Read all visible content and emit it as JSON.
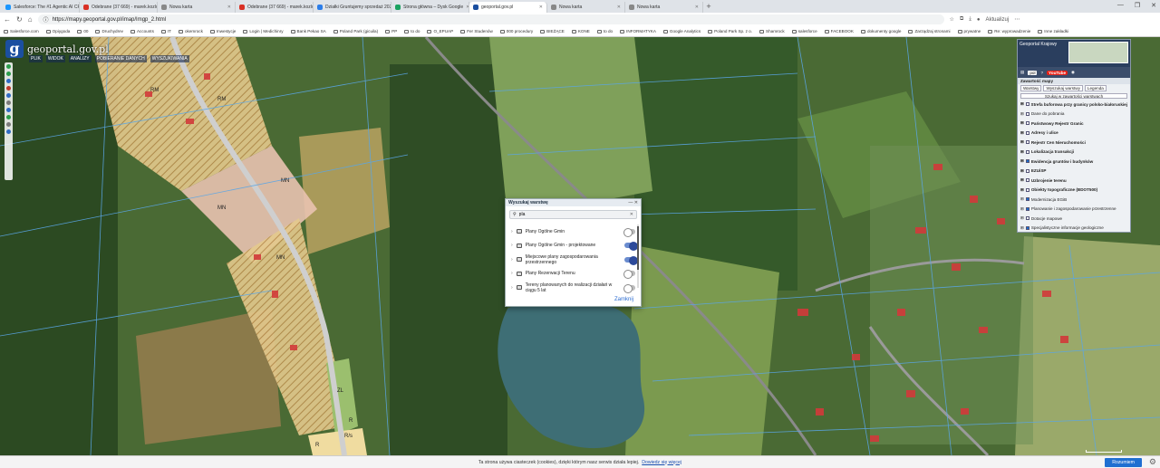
{
  "browser": {
    "tabs": [
      {
        "title": "Salesforce: The #1 Agentic AI CR",
        "color": "#1b96ff"
      },
      {
        "title": "Odebrane (37 669) - marek.kozlo",
        "color": "#d93025"
      },
      {
        "title": "Nowa karta",
        "color": "#888888"
      },
      {
        "title": "Odebrane (37 669) - marek.kozlo",
        "color": "#d93025"
      },
      {
        "title": "Działki Gruntujemy sprzedaż 2021",
        "color": "#2b7de9"
      },
      {
        "title": "Strona główna – Dysk Google",
        "color": "#1aa260"
      },
      {
        "title": "geoportal.gov.pl",
        "color": "#1b4fa0",
        "active": true
      },
      {
        "title": "Nowa karta",
        "color": "#888888"
      },
      {
        "title": "Nowa karta",
        "color": "#888888"
      }
    ],
    "url": "https://mapy.geoportal.gov.pl/imap/Imgp_2.html",
    "update_label": "Aktualizuj",
    "window_controls": [
      "—",
      "❐",
      "✕"
    ],
    "bookmarks": [
      "Salesforce.com",
      "Opiygoda",
      "00",
      "Druchydrev",
      "Accounts",
      "IT",
      "okemrock",
      "Inwestycje",
      "Login | Medichinry",
      "Bank Pekao SA",
      "Poland Park (gicuila)",
      "PP",
      "to do",
      "O_EPUAP",
      "Fer Studenów",
      "000 procedury",
      "BIEŻĄCE",
      "KONE",
      "to do",
      "INFORMATYKA",
      "Google Analytics",
      "Poland Park Sp. z o.",
      "Shamrock",
      "salesforce",
      "FACEBOOK",
      "dokumenty google",
      "Zarządzaj stronami",
      "prywatne",
      "Re: wyprowadzenie",
      "Inne zakładki"
    ]
  },
  "geoportal": {
    "logo_text": "geoportal.gov.pl",
    "menu": [
      "PLIK",
      "WIDOK",
      "ANALIZY",
      "POBIERANIE DANYCH",
      "WYSZUKIWANIA"
    ],
    "map_labels": [
      "RM",
      "RM",
      "MN",
      "MN",
      "MN",
      "ZL",
      "R",
      "R",
      "R/s"
    ],
    "right_panel": {
      "header": "Geoportal Krajowy",
      "select_value": "pol",
      "youtube_label": "YouTube",
      "title": "Zawartość mapy",
      "tabs": [
        "Warstwy",
        "Wyszukaj warstwy",
        "Legenda"
      ],
      "search_label": "Szukaj w zawartości warstwach",
      "layers": [
        {
          "name": "Strefa buforowa przy granicy polsko-białoruskiej",
          "bold": true,
          "on": false
        },
        {
          "name": "Dane do pobrania",
          "bold": false,
          "on": false
        },
        {
          "name": "Państwowy Rejestr Granic",
          "bold": true,
          "on": false
        },
        {
          "name": "Adresy i ulice",
          "bold": true,
          "on": false
        },
        {
          "name": "Rejestr Cen Nieruchomości",
          "bold": true,
          "on": false
        },
        {
          "name": "Lokalizacja transakcji",
          "bold": true,
          "on": false
        },
        {
          "name": "Ewidencja gruntów i budynków",
          "bold": true,
          "on": true
        },
        {
          "name": "EZUiSP",
          "bold": true,
          "on": false
        },
        {
          "name": "Uzbrojenie terenu",
          "bold": true,
          "on": false
        },
        {
          "name": "Obiekty topograficzne (BDOT500)",
          "bold": true,
          "on": false
        },
        {
          "name": "Modernizacja EGiB",
          "bold": false,
          "on": true
        },
        {
          "name": "Planowanie i zagospodarowanie przestrzenne",
          "bold": false,
          "on": true
        },
        {
          "name": "Dotacje mapowe",
          "bold": false,
          "on": false
        },
        {
          "name": "Specjalistyczne informacje geologiczne",
          "bold": false,
          "on": true
        }
      ]
    },
    "dialog": {
      "title": "Wyszukaj warstwę",
      "search_value": "pla",
      "items": [
        {
          "name": "Plany Ogólne Gmin",
          "on": false
        },
        {
          "name": "Plany Ogólne Gmin - projektowane",
          "on": true
        },
        {
          "name": "Miejscowe plany zagospodarowania przestrzennego",
          "on": true
        },
        {
          "name": "Plany Rezerwacji Terenu",
          "on": false
        },
        {
          "name": "Tereny planowanych do realizacji działań w ciągu 5 lat",
          "on": false
        }
      ],
      "close_label": "Zamknij"
    }
  },
  "cookie": {
    "text": "Ta strona używa ciasteczek (cookies), dzięki którym nasz serwis działa lepiej.",
    "link": "Dowiedz się więcej",
    "button": "Rozumiem"
  }
}
